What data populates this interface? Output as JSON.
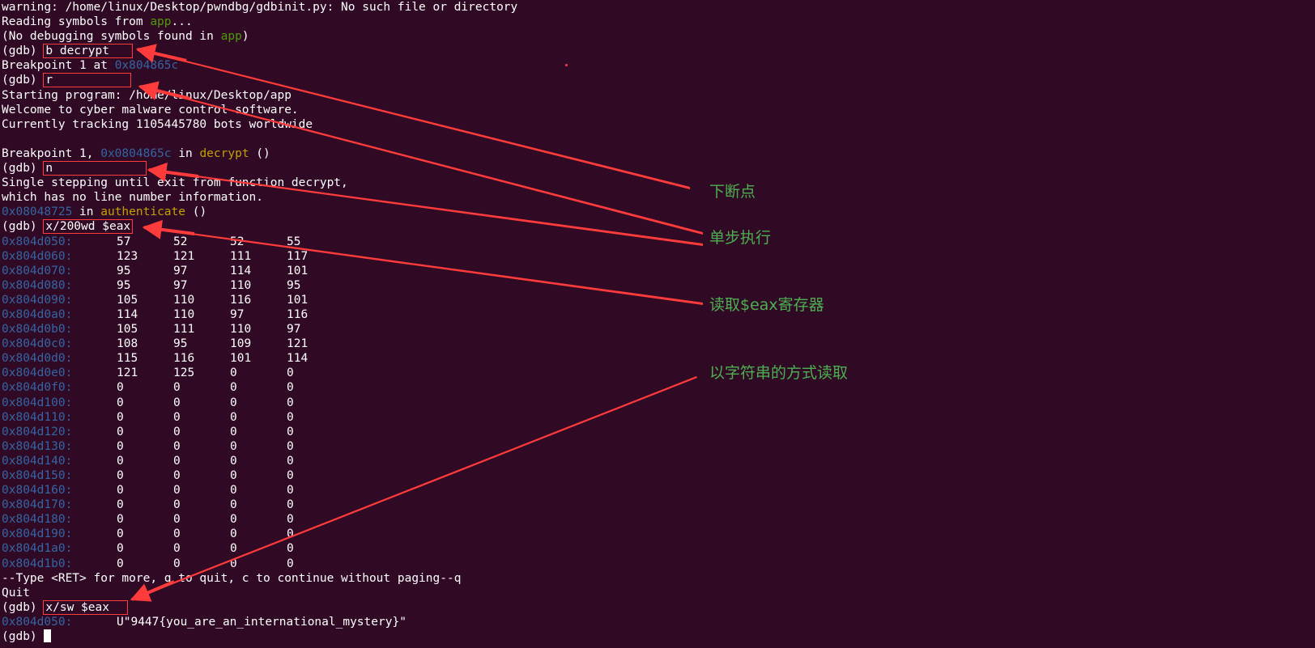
{
  "colors": {
    "background": "#300a24",
    "text": "#ffffff",
    "address": "#3465a4",
    "program": "#4e9a06",
    "function": "#c4a000",
    "annotation": "#4caf50",
    "arrow": "#ff3b3b"
  },
  "lines": {
    "l0": "warning: /home/linux/Desktop/pwndbg/gdbinit.py: No such file or directory",
    "l1_pre": "Reading symbols from ",
    "l1_app": "app",
    "l1_post": "...",
    "l2_pre": "(No debugging symbols found in ",
    "l2_app": "app",
    "l2_post": ")",
    "prompt": "(gdb) ",
    "cmd1": "b decrypt",
    "bp_set_pre": "Breakpoint 1 at ",
    "bp_set_addr": "0x804865c",
    "cmd2": "r",
    "start": "Starting program: /home/linux/Desktop/app",
    "welcome": "Welcome to cyber malware control software.",
    "tracking": "Currently tracking 1105445780 bots worldwide",
    "bp_hit_pre": "Breakpoint 1, ",
    "bp_hit_addr": "0x0804865c",
    "bp_hit_in": " in ",
    "bp_hit_func": "decrypt",
    "bp_hit_post": " ()",
    "cmd3": "n",
    "single1": "Single stepping until exit from function decrypt,",
    "single2": "which has no line number information.",
    "ret_addr": "0x08048725",
    "ret_in": " in ",
    "ret_func": "authenticate",
    "ret_post": " ()",
    "cmd4": "x/200wd $eax",
    "paging": "--Type <RET> for more, q to quit, c to continue without paging--q",
    "quit": "Quit",
    "cmd5": "x/sw $eax",
    "str_addr": "0x804d050:",
    "str_value": "U\"9447{you_are_an_international_mystery}\""
  },
  "memory": [
    {
      "addr": "0x804d050:",
      "vals": [
        "57",
        "52",
        "52",
        "55"
      ]
    },
    {
      "addr": "0x804d060:",
      "vals": [
        "123",
        "121",
        "111",
        "117"
      ]
    },
    {
      "addr": "0x804d070:",
      "vals": [
        "95",
        "97",
        "114",
        "101"
      ]
    },
    {
      "addr": "0x804d080:",
      "vals": [
        "95",
        "97",
        "110",
        "95"
      ]
    },
    {
      "addr": "0x804d090:",
      "vals": [
        "105",
        "110",
        "116",
        "101"
      ]
    },
    {
      "addr": "0x804d0a0:",
      "vals": [
        "114",
        "110",
        "97",
        "116"
      ]
    },
    {
      "addr": "0x804d0b0:",
      "vals": [
        "105",
        "111",
        "110",
        "97"
      ]
    },
    {
      "addr": "0x804d0c0:",
      "vals": [
        "108",
        "95",
        "109",
        "121"
      ]
    },
    {
      "addr": "0x804d0d0:",
      "vals": [
        "115",
        "116",
        "101",
        "114"
      ]
    },
    {
      "addr": "0x804d0e0:",
      "vals": [
        "121",
        "125",
        "0",
        "0"
      ]
    },
    {
      "addr": "0x804d0f0:",
      "vals": [
        "0",
        "0",
        "0",
        "0"
      ]
    },
    {
      "addr": "0x804d100:",
      "vals": [
        "0",
        "0",
        "0",
        "0"
      ]
    },
    {
      "addr": "0x804d110:",
      "vals": [
        "0",
        "0",
        "0",
        "0"
      ]
    },
    {
      "addr": "0x804d120:",
      "vals": [
        "0",
        "0",
        "0",
        "0"
      ]
    },
    {
      "addr": "0x804d130:",
      "vals": [
        "0",
        "0",
        "0",
        "0"
      ]
    },
    {
      "addr": "0x804d140:",
      "vals": [
        "0",
        "0",
        "0",
        "0"
      ]
    },
    {
      "addr": "0x804d150:",
      "vals": [
        "0",
        "0",
        "0",
        "0"
      ]
    },
    {
      "addr": "0x804d160:",
      "vals": [
        "0",
        "0",
        "0",
        "0"
      ]
    },
    {
      "addr": "0x804d170:",
      "vals": [
        "0",
        "0",
        "0",
        "0"
      ]
    },
    {
      "addr": "0x804d180:",
      "vals": [
        "0",
        "0",
        "0",
        "0"
      ]
    },
    {
      "addr": "0x804d190:",
      "vals": [
        "0",
        "0",
        "0",
        "0"
      ]
    },
    {
      "addr": "0x804d1a0:",
      "vals": [
        "0",
        "0",
        "0",
        "0"
      ]
    },
    {
      "addr": "0x804d1b0:",
      "vals": [
        "0",
        "0",
        "0",
        "0"
      ]
    }
  ],
  "annotations": {
    "breakpoint": "下断点",
    "step": "单步执行",
    "read_eax": "读取$eax寄存器",
    "read_string": "以字符串的方式读取"
  }
}
